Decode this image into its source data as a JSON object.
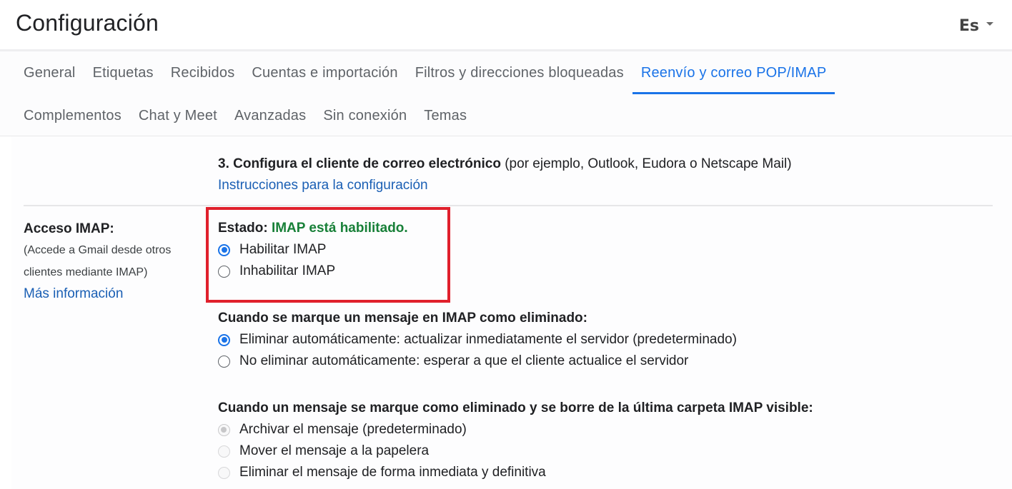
{
  "header": {
    "title": "Configuración",
    "language": {
      "label": "Es",
      "icon": "caret-down-icon"
    }
  },
  "tabs": {
    "row1": [
      {
        "label": "General",
        "active": false
      },
      {
        "label": "Etiquetas",
        "active": false
      },
      {
        "label": "Recibidos",
        "active": false
      },
      {
        "label": "Cuentas e importación",
        "active": false
      },
      {
        "label": "Filtros y direcciones bloqueadas",
        "active": false
      },
      {
        "label": "Reenvío y correo POP/IMAP",
        "active": true
      }
    ],
    "row2": [
      {
        "label": "Complementos",
        "active": false
      },
      {
        "label": "Chat y Meet",
        "active": false
      },
      {
        "label": "Avanzadas",
        "active": false
      },
      {
        "label": "Sin conexión",
        "active": false
      },
      {
        "label": "Temas",
        "active": false
      }
    ]
  },
  "intro": {
    "step_bold": "3. Configura el cliente de correo electrónico",
    "step_rest": " (por ejemplo, Outlook, Eudora o Netscape Mail)",
    "instructions_link": "Instrucciones para la configuración"
  },
  "imap_access": {
    "heading": "Acceso IMAP:",
    "description": "(Accede a Gmail desde otros clientes mediante IMAP)",
    "more_info_link": "Más información",
    "status_label": "Estado: ",
    "status_value": "IMAP está habilitado.",
    "status_color": "#188038",
    "highlight_color": "#e0202c",
    "options": [
      {
        "label": "Habilitar IMAP",
        "checked": true,
        "disabled": false
      },
      {
        "label": "Inhabilitar IMAP",
        "checked": false,
        "disabled": false
      }
    ]
  },
  "on_deleted": {
    "title": "Cuando se marque un mensaje en IMAP como eliminado:",
    "options": [
      {
        "label": "Eliminar automáticamente: actualizar inmediatamente el servidor (predeterminado)",
        "checked": true,
        "disabled": false
      },
      {
        "label": "No eliminar automáticamente: esperar a que el cliente actualice el servidor",
        "checked": false,
        "disabled": false
      }
    ]
  },
  "on_expunged": {
    "title": "Cuando un mensaje se marque como eliminado y se borre de la última carpeta IMAP visible:",
    "options": [
      {
        "label": "Archivar el mensaje (predeterminado)",
        "checked": true,
        "disabled": true
      },
      {
        "label": "Mover el mensaje a la papelera",
        "checked": false,
        "disabled": true
      },
      {
        "label": "Eliminar el mensaje de forma inmediata y definitiva",
        "checked": false,
        "disabled": true
      }
    ]
  },
  "colors": {
    "accent": "#1a73e8",
    "link": "#1a5fb4"
  }
}
